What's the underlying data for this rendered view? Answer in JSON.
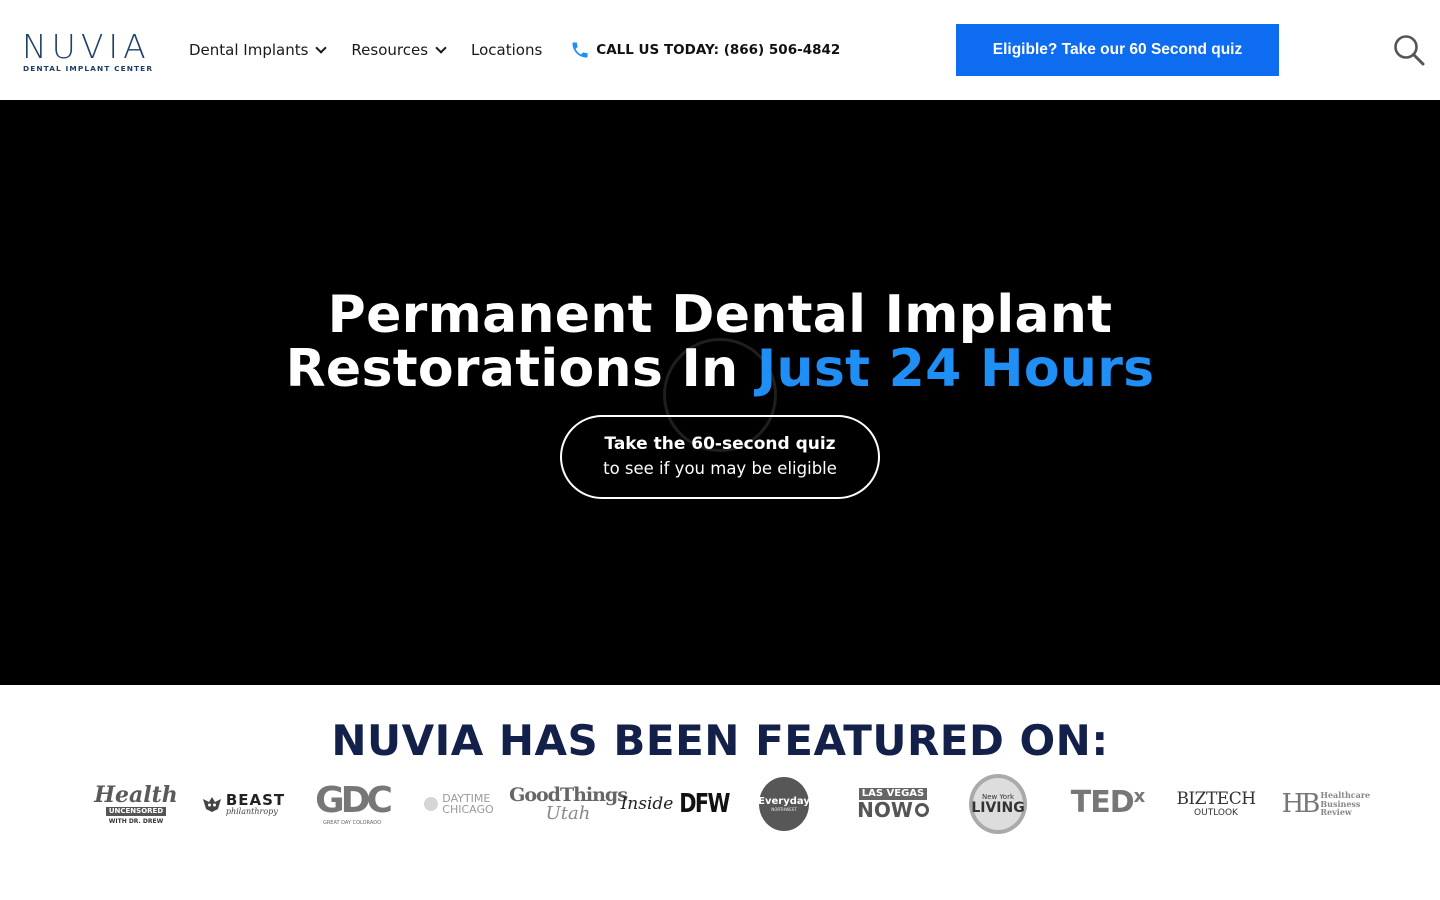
{
  "header": {
    "logo": {
      "word": "NUVIA",
      "sub": "DENTAL IMPLANT CENTER"
    },
    "nav": [
      {
        "label": "Dental Implants",
        "has_dropdown": true
      },
      {
        "label": "Resources",
        "has_dropdown": true
      },
      {
        "label": "Locations",
        "has_dropdown": false
      }
    ],
    "phone_label": "CALL US TODAY: (866) 506-4842",
    "cta_label": "Eligible? Take our 60 Second quiz",
    "search_icon": "search-icon"
  },
  "hero": {
    "title_line1": "Permanent Dental Implant",
    "title_line2_pre": "Restorations In ",
    "title_line2_accent": "Just 24 Hours",
    "quiz_line1": "Take the 60-second quiz",
    "quiz_line2": "to see if you may be eligible"
  },
  "featured": {
    "title": "NUVIA HAS BEEN FEATURED ON:",
    "logos": [
      {
        "name": "health-uncensored",
        "main": "Health",
        "tag": "UNCENSORED",
        "sub": "WITH DR. DREW"
      },
      {
        "name": "beast-philanthropy",
        "main": "BEAST",
        "sub": "philanthropy"
      },
      {
        "name": "gdc",
        "main": "GDC",
        "sub": "GREAT DAY COLORADO"
      },
      {
        "name": "daytime-chicago",
        "main": "DAYTIME",
        "sub": "CHICAGO"
      },
      {
        "name": "good-things-utah",
        "main": "GoodThings",
        "sub": "Utah"
      },
      {
        "name": "inside-dfw",
        "main": "Inside",
        "sub": "DFW"
      },
      {
        "name": "everyday-northwest",
        "main": "Everyday",
        "sub": "NORTHWEST"
      },
      {
        "name": "las-vegas-now",
        "main": "LAS VEGAS",
        "sub": "NOW"
      },
      {
        "name": "new-york-living",
        "main": "New York",
        "sub": "LIVING"
      },
      {
        "name": "tedx",
        "main": "TED",
        "sub": "x"
      },
      {
        "name": "biztech-outlook",
        "main": "BIZTECH",
        "sub": "OUTLOOK"
      },
      {
        "name": "healthcare-business-review",
        "main": "HB",
        "sub": "Healthcare Business Review"
      }
    ]
  },
  "colors": {
    "brand_navy": "#13214a",
    "logo_navy": "#1e3f66",
    "cta_blue": "#0e6cf0",
    "accent_blue": "#1f8ef5",
    "hero_bg": "#000000"
  }
}
